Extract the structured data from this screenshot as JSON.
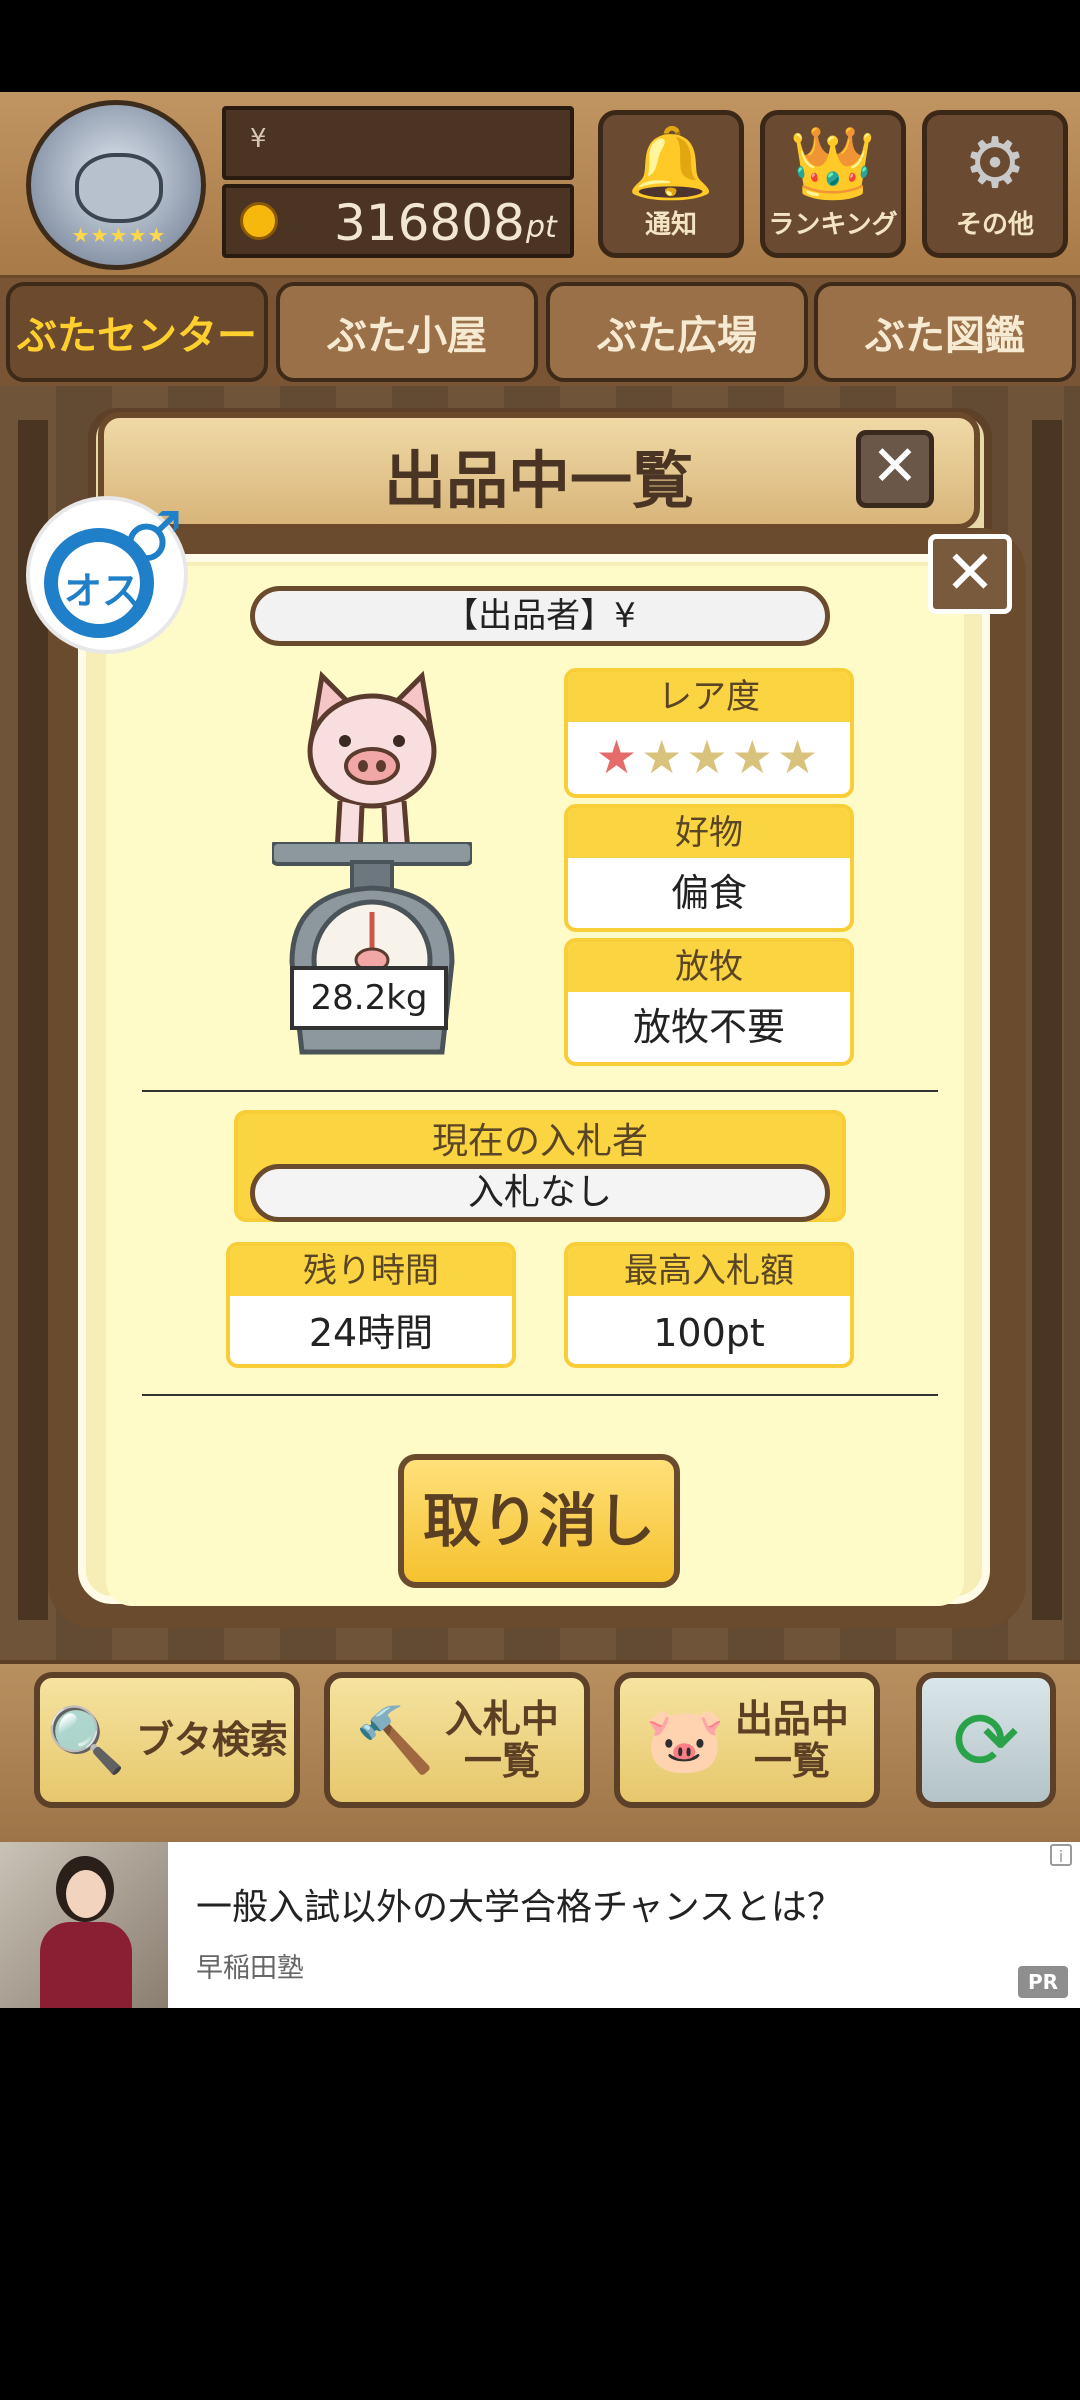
{
  "header": {
    "yen_label": "¥",
    "points_value": "316808",
    "points_unit": "pt",
    "buttons": [
      {
        "label": "通知",
        "icon": "bell-icon"
      },
      {
        "label": "ランキング",
        "icon": "crown-icon"
      },
      {
        "label": "その他",
        "icon": "gear-icon"
      }
    ]
  },
  "tabs": [
    {
      "label": "ぶたセンター",
      "active": true
    },
    {
      "label": "ぶた小屋",
      "active": false
    },
    {
      "label": "ぶた広場",
      "active": false
    },
    {
      "label": "ぶた図鑑",
      "active": false
    }
  ],
  "back_dialog": {
    "title": "出品中一覧",
    "close": "✕"
  },
  "listing": {
    "close": "✕",
    "gender_label": "オス",
    "gender_symbol": "♂",
    "seller": "【出品者】¥",
    "weight": "28.2kg",
    "rarity_label": "レア度",
    "rarity_stars": 1,
    "rarity_max": 5,
    "food_label": "好物",
    "food_value": "偏食",
    "pasture_label": "放牧",
    "pasture_value": "放牧不要",
    "bidder_label": "現在の入札者",
    "bidder_value": "入札なし",
    "remaining_label": "残り時間",
    "remaining_value": "24時間",
    "maxbid_label": "最高入札額",
    "maxbid_value": "100pt",
    "cancel_button": "取り消し"
  },
  "toolbar": {
    "search_label": "ブタ検索",
    "bidding_label": "入札中\n一覧",
    "listing_label": "出品中\n一覧"
  },
  "ad": {
    "title": "一般入試以外の大学合格チャンスとは？",
    "source": "早稲田塾",
    "pr": "PR",
    "info": "i"
  }
}
